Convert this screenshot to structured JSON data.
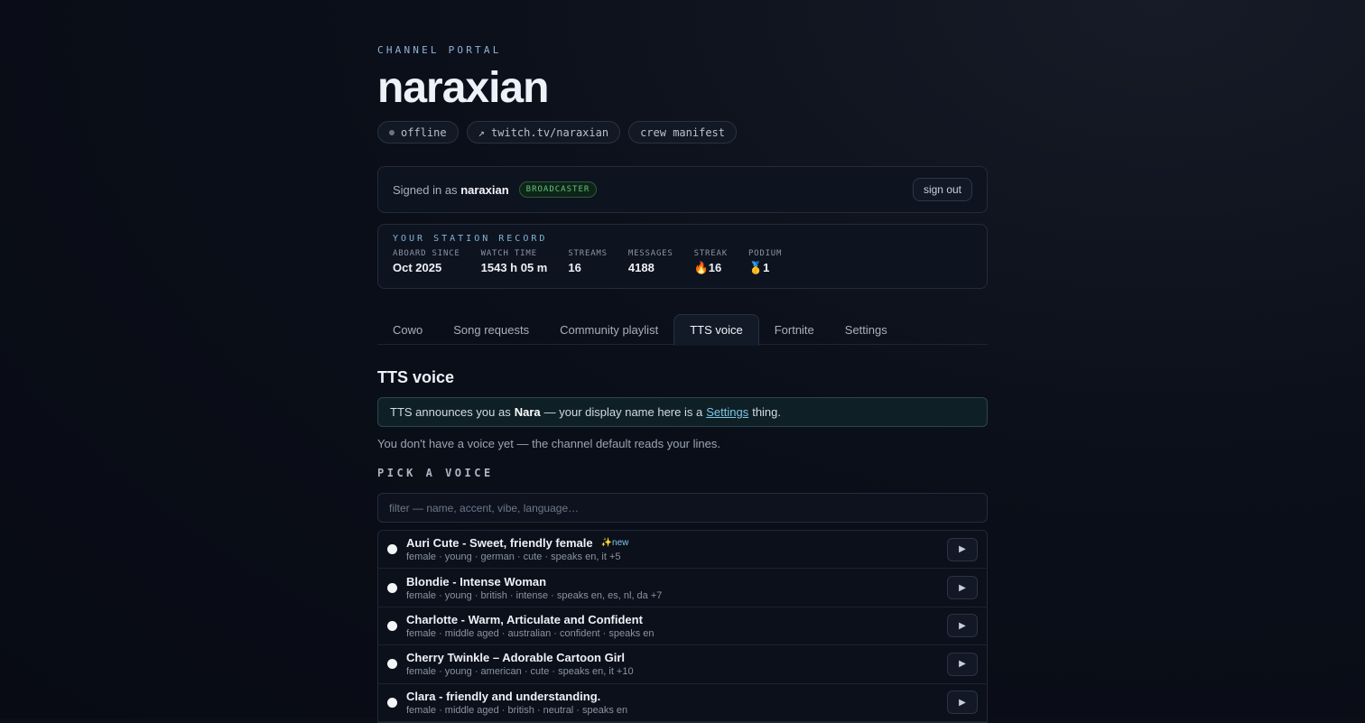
{
  "header": {
    "eyebrow": "CHANNEL PORTAL",
    "title": "naraxian",
    "pills": {
      "status": "offline",
      "link": "↗ twitch.tv/naraxian",
      "manifest": "crew manifest"
    }
  },
  "signin": {
    "prefix": "Signed in as",
    "user": "naraxian",
    "badge": "BROADCASTER",
    "signout": "sign out"
  },
  "record": {
    "heading": "YOUR STATION RECORD",
    "stats": [
      {
        "label": "ABOARD SINCE",
        "value": "Oct 2025"
      },
      {
        "label": "WATCH TIME",
        "value": "1543 h 05 m"
      },
      {
        "label": "STREAMS",
        "value": "16"
      },
      {
        "label": "MESSAGES",
        "value": "4188"
      },
      {
        "label": "STREAK",
        "value": "🔥16"
      },
      {
        "label": "PODIUM",
        "value": "🥇1"
      }
    ]
  },
  "tabs": [
    "Cowo",
    "Song requests",
    "Community playlist",
    "TTS voice",
    "Fortnite",
    "Settings"
  ],
  "active_tab": "TTS voice",
  "tts": {
    "title": "TTS voice",
    "info_prefix": "TTS announces you as",
    "info_name": "Nara",
    "info_mid": "— your display name here is a",
    "info_link": "Settings",
    "info_suffix": "thing.",
    "hint": "You don't have a voice yet — the channel default reads your lines.",
    "pick_heading": "PICK A VOICE",
    "filter_placeholder": "filter — name, accent, vibe, language…",
    "filter_value": ""
  },
  "voices": [
    {
      "name": "Auri Cute - Sweet, friendly female",
      "tag": "✨new",
      "meta": "female · young · german · cute · speaks en, it +5"
    },
    {
      "name": "Blondie - Intense Woman",
      "tag": "",
      "meta": "female · young · british · intense · speaks en, es, nl, da +7"
    },
    {
      "name": "Charlotte - Warm, Articulate and Confident",
      "tag": "",
      "meta": "female · middle aged · australian · confident · speaks en"
    },
    {
      "name": "Cherry Twinkle – Adorable Cartoon Girl",
      "tag": "",
      "meta": "female · young · american · cute · speaks en, it +10"
    },
    {
      "name": "Clara - friendly and understanding.",
      "tag": "",
      "meta": "female · middle aged · british · neutral · speaks en"
    }
  ],
  "icons": {
    "play": "play-icon",
    "status_dot": "status-dot-icon"
  },
  "colors": {
    "accent": "#7cc6e4",
    "badge_green": "#5fc47b",
    "background": "#0a0e18"
  }
}
